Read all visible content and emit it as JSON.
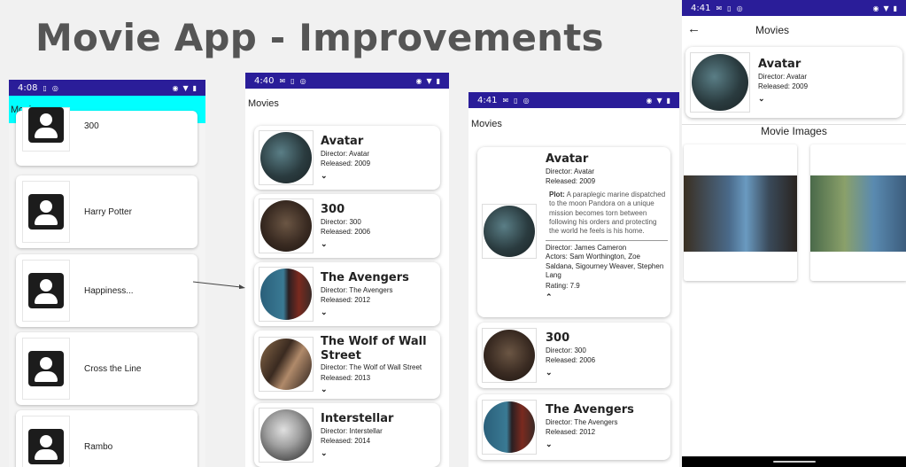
{
  "slide": {
    "title": "Movie App - Improvements"
  },
  "phone1": {
    "status_time": "4:08",
    "app_title": "Movies",
    "items": [
      {
        "title": "300"
      },
      {
        "title": "Harry Potter"
      },
      {
        "title": "Happiness..."
      },
      {
        "title": "Cross the Line"
      },
      {
        "title": "Rambo"
      }
    ]
  },
  "phone2": {
    "status_time": "4:40",
    "app_title": "Movies",
    "items": [
      {
        "title": "Avatar",
        "director": "Director: Avatar",
        "released": "Released: 2009"
      },
      {
        "title": "300",
        "director": "Director: 300",
        "released": "Released: 2006"
      },
      {
        "title": "The Avengers",
        "director": "Director: The Avengers",
        "released": "Released: 2012"
      },
      {
        "title": "The Wolf of Wall Street",
        "director": "Director: The Wolf of Wall Street",
        "released": "Released: 2013"
      },
      {
        "title": "Interstellar",
        "director": "Director: Interstellar",
        "released": "Released: 2014"
      }
    ]
  },
  "phone3": {
    "status_time": "4:41",
    "app_title": "Movies",
    "expanded": {
      "title": "Avatar",
      "director": "Director: Avatar",
      "released": "Released: 2009",
      "plot_label": "Plot:",
      "plot": "A paraplegic marine dispatched to the moon Pandora on a unique mission becomes torn between following his orders and protecting the world he feels is his home.",
      "director_full": "Director: James Cameron",
      "actors": "Actors: Sam Worthington, Zoe Saldana, Sigourney Weaver, Stephen Lang",
      "rating": "Rating: 7.9"
    },
    "items": [
      {
        "title": "300",
        "director": "Director: 300",
        "released": "Released: 2006"
      },
      {
        "title": "The Avengers",
        "director": "Director: The Avengers",
        "released": "Released: 2012"
      }
    ]
  },
  "phone4": {
    "status_time": "4:41",
    "title": "Movies",
    "movie": {
      "title": "Avatar",
      "director": "Director: Avatar",
      "released": "Released: 2009"
    },
    "images_heading": "Movie Images"
  },
  "icons": {
    "back": "arrow-left-icon",
    "expand": "chevron-down-icon",
    "collapse": "chevron-up-icon",
    "placeholder": "person-placeholder-icon"
  },
  "colors": {
    "status_bar": "#2a1d99",
    "old_toolbar": "#00ffff",
    "title_text": "#555555"
  }
}
